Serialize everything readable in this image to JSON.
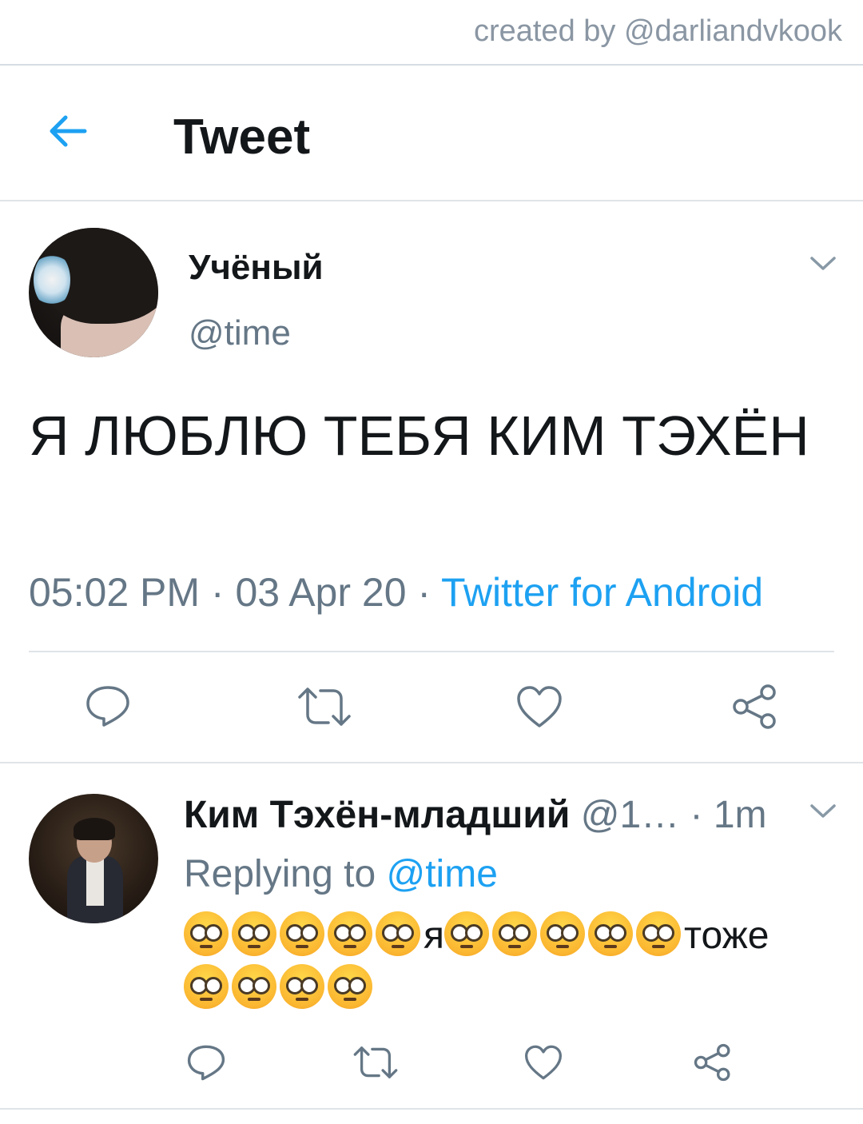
{
  "credit": "created by @darliandvkook",
  "header": {
    "title": "Tweet",
    "back_icon": "back-arrow-icon",
    "accent": "#1da1f2"
  },
  "tweet": {
    "name": "Учёный",
    "handle": "@time",
    "text": "Я ЛЮБЛЮ ТЕБЯ КИМ ТЭХЁН",
    "time": "05:02 PM · 03 Apr 20 · ",
    "source": "Twitter for Android",
    "actions": [
      "reply-icon",
      "retweet-icon",
      "like-icon",
      "share-icon"
    ]
  },
  "reply": {
    "name": "Ким Тэхён-младший",
    "handle": " @1…",
    "time": " · 1m",
    "replying_prefix": "Replying to ",
    "replying_to": "@time",
    "text_parts": {
      "emoji_name": "flushed-face-emoji",
      "word_1": "я",
      "word_2": "тоже"
    },
    "actions": [
      "reply-icon",
      "retweet-icon",
      "like-icon",
      "share-icon"
    ]
  },
  "colors": {
    "text": "#14171a",
    "secondary": "#657786",
    "link": "#1da1f2",
    "divider": "#dfe4e8"
  }
}
